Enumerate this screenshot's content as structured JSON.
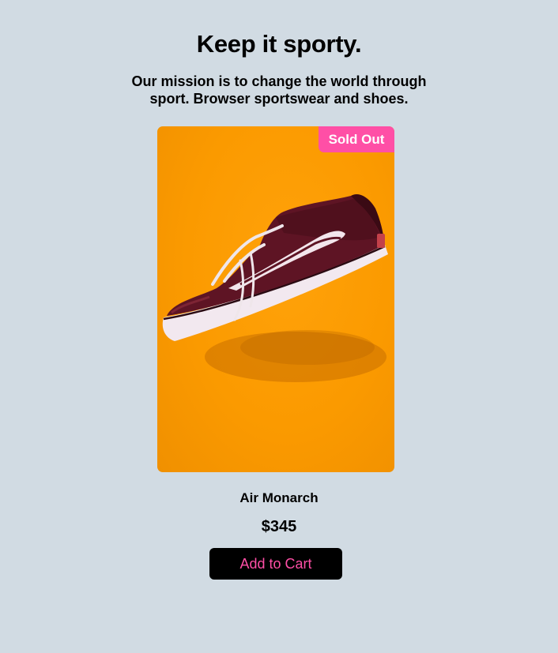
{
  "hero": {
    "title": "Keep it sporty.",
    "subtitle": "Our mission is to change the world through sport. Browser sportswear and shoes."
  },
  "product": {
    "badge": "Sold Out",
    "name": "Air Monarch",
    "price": "$345",
    "cta_label": "Add to Cart",
    "image_subject": "maroon-sneaker-on-orange-background"
  },
  "colors": {
    "page_background": "#d1dbe3",
    "accent": "#ff4fa6",
    "button_background": "#000000",
    "image_background": "#fb9a00",
    "shoe_upper": "#5e1424"
  }
}
